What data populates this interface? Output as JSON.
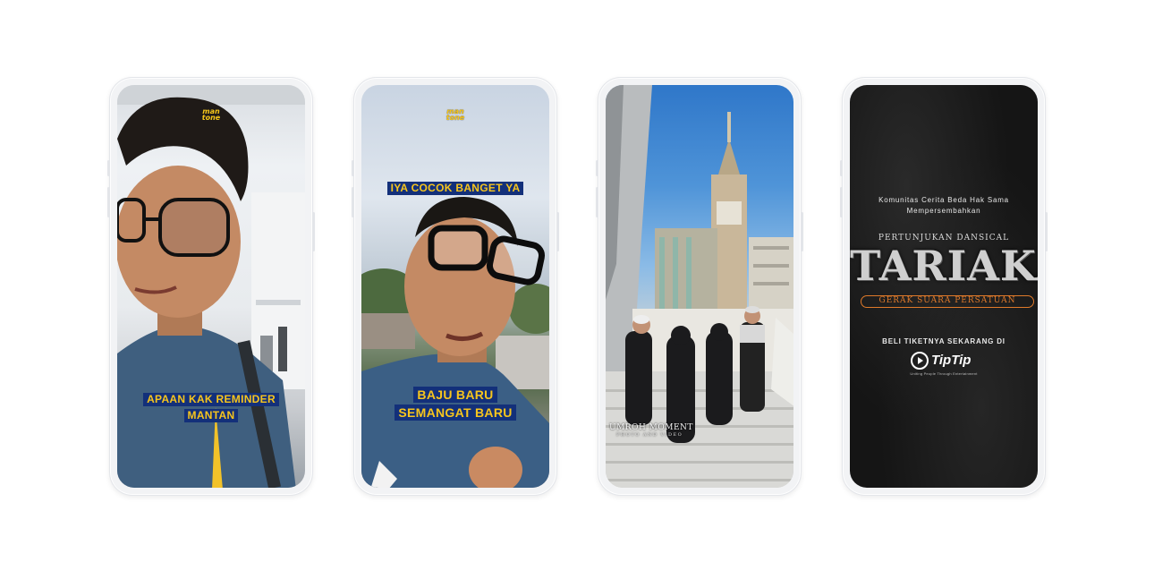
{
  "phones": [
    {
      "logo": {
        "line1": "man",
        "line2": "tone"
      },
      "caption": [
        "APAAN KAK REMINDER",
        "MANTAN"
      ]
    },
    {
      "logo": {
        "line1": "man",
        "line2": "tone"
      },
      "top_caption": "IYA COCOK BANGET YA",
      "caption": [
        "BAJU BARU",
        "SEMANGAT BARU"
      ]
    },
    {
      "watermark": {
        "title": "UMROH MOMENT",
        "subtitle": "PHOTO AND VIDEO"
      }
    },
    {
      "presenter_line1": "Komunitas Cerita Beda Hak Sama",
      "presenter_line2": "Mempersembahkan",
      "show_type": "PERTUNJUKAN DANSICAL",
      "title": "TARIAKAN",
      "subtitle": "GERAK SUARA PERSATUAN",
      "cta": "BELI TIKETNYA SEKARANG DI",
      "brand": "TipTip",
      "brand_tagline": "Uniting People Through Entertainment"
    }
  ],
  "colors": {
    "caption_bg": "#13307a",
    "caption_text": "#f7c51d",
    "logo_yellow": "#f5c518",
    "tariakan_accent": "#e07a2a"
  }
}
